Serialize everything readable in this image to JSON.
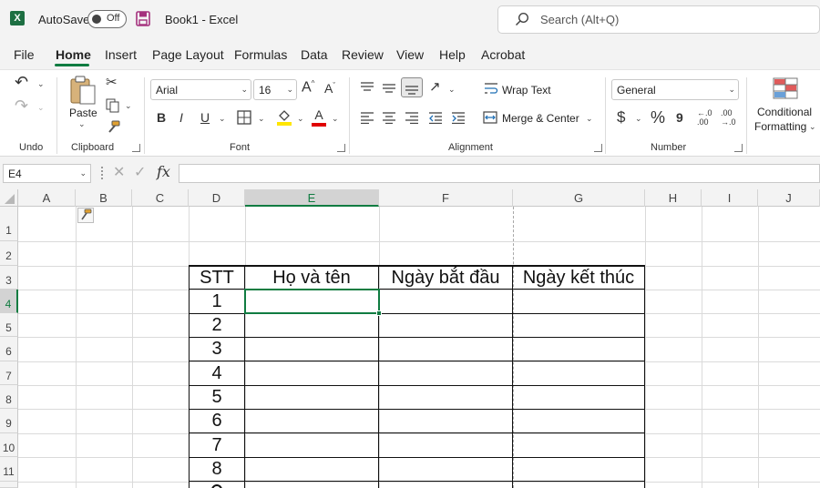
{
  "title_bar": {
    "autosave_label": "AutoSave",
    "autosave_state": "Off",
    "doc_title": "Book1  -  Excel",
    "search_placeholder": "Search (Alt+Q)"
  },
  "menu": [
    "File",
    "Home",
    "Insert",
    "Page Layout",
    "Formulas",
    "Data",
    "Review",
    "View",
    "Help",
    "Acrobat"
  ],
  "ribbon": {
    "undo_group": "Undo",
    "clipboard": {
      "paste": "Paste",
      "group": "Clipboard"
    },
    "font": {
      "name": "Arial",
      "size": "16",
      "grow": "A",
      "shrink": "A",
      "bold": "B",
      "italic": "I",
      "underline": "U",
      "color_letter": "A",
      "group": "Font"
    },
    "alignment": {
      "wrap_text": "Wrap Text",
      "merge_center": "Merge & Center",
      "group": "Alignment"
    },
    "number": {
      "format": "General",
      "currency": "$",
      "percent": "%",
      "comma": "9",
      "inc_decimal": "←.0\n.00",
      "dec_decimal": ".00\n→.0",
      "group": "Number"
    },
    "styles": {
      "conditional": "Conditional",
      "formatting": "Formatting"
    }
  },
  "formula_bar": {
    "name_box": "E4",
    "fx": "fx",
    "value": ""
  },
  "columns": [
    "A",
    "B",
    "C",
    "D",
    "E",
    "F",
    "G",
    "H",
    "I",
    "J"
  ],
  "rows": [
    "1",
    "2",
    "3",
    "4",
    "5",
    "6",
    "7",
    "8",
    "9",
    "10",
    "11"
  ],
  "selected": {
    "column": "E",
    "row": "4"
  },
  "table": {
    "headers": [
      "STT",
      "Họ và tên",
      "Ngày bắt đầu",
      "Ngày kết thúc"
    ],
    "numbers": [
      "1",
      "2",
      "3",
      "4",
      "5",
      "6",
      "7",
      "8"
    ]
  },
  "colors": {
    "accent": "#107c41",
    "excel_green": "#1d6f42",
    "save_purple": "#a4307d"
  }
}
